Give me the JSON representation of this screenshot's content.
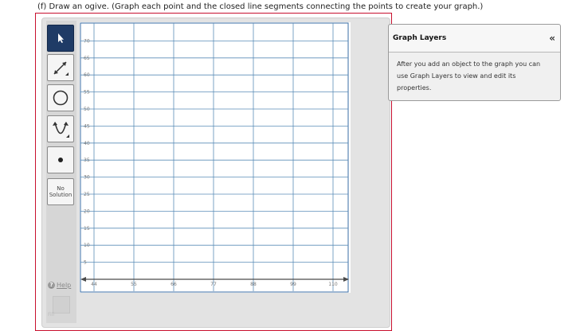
{
  "question": {
    "text": "(f) Draw an ogive. (Graph each point and the closed line segments connecting the points to create your graph.)"
  },
  "toolbar": {
    "tools": [
      {
        "name": "pointer-tool",
        "icon": "arrow-pointer-icon",
        "selected": true
      },
      {
        "name": "line-segment-tool",
        "icon": "line-segment-icon"
      },
      {
        "name": "circle-tool",
        "icon": "circle-icon"
      },
      {
        "name": "parabola-tool",
        "icon": "parabola-icon"
      },
      {
        "name": "point-tool",
        "icon": "point-icon"
      }
    ],
    "no_solution_line1": "No",
    "no_solution_line2": "Solution",
    "help_label": "Help",
    "disabled_tool_label": "Fill"
  },
  "graph": {
    "x_ticks": [
      44,
      55,
      66,
      77,
      88,
      99,
      110
    ],
    "y_ticks": [
      5,
      10,
      15,
      20,
      25,
      30,
      35,
      40,
      45,
      50,
      55,
      60,
      65,
      70
    ],
    "grid_color": "#5b8db8",
    "axis_color": "#3a6ea5"
  },
  "layers": {
    "title": "Graph Layers",
    "collapse_icon": "«",
    "body": "After you add an object to the graph you can use Graph Layers to view and edit its properties."
  }
}
